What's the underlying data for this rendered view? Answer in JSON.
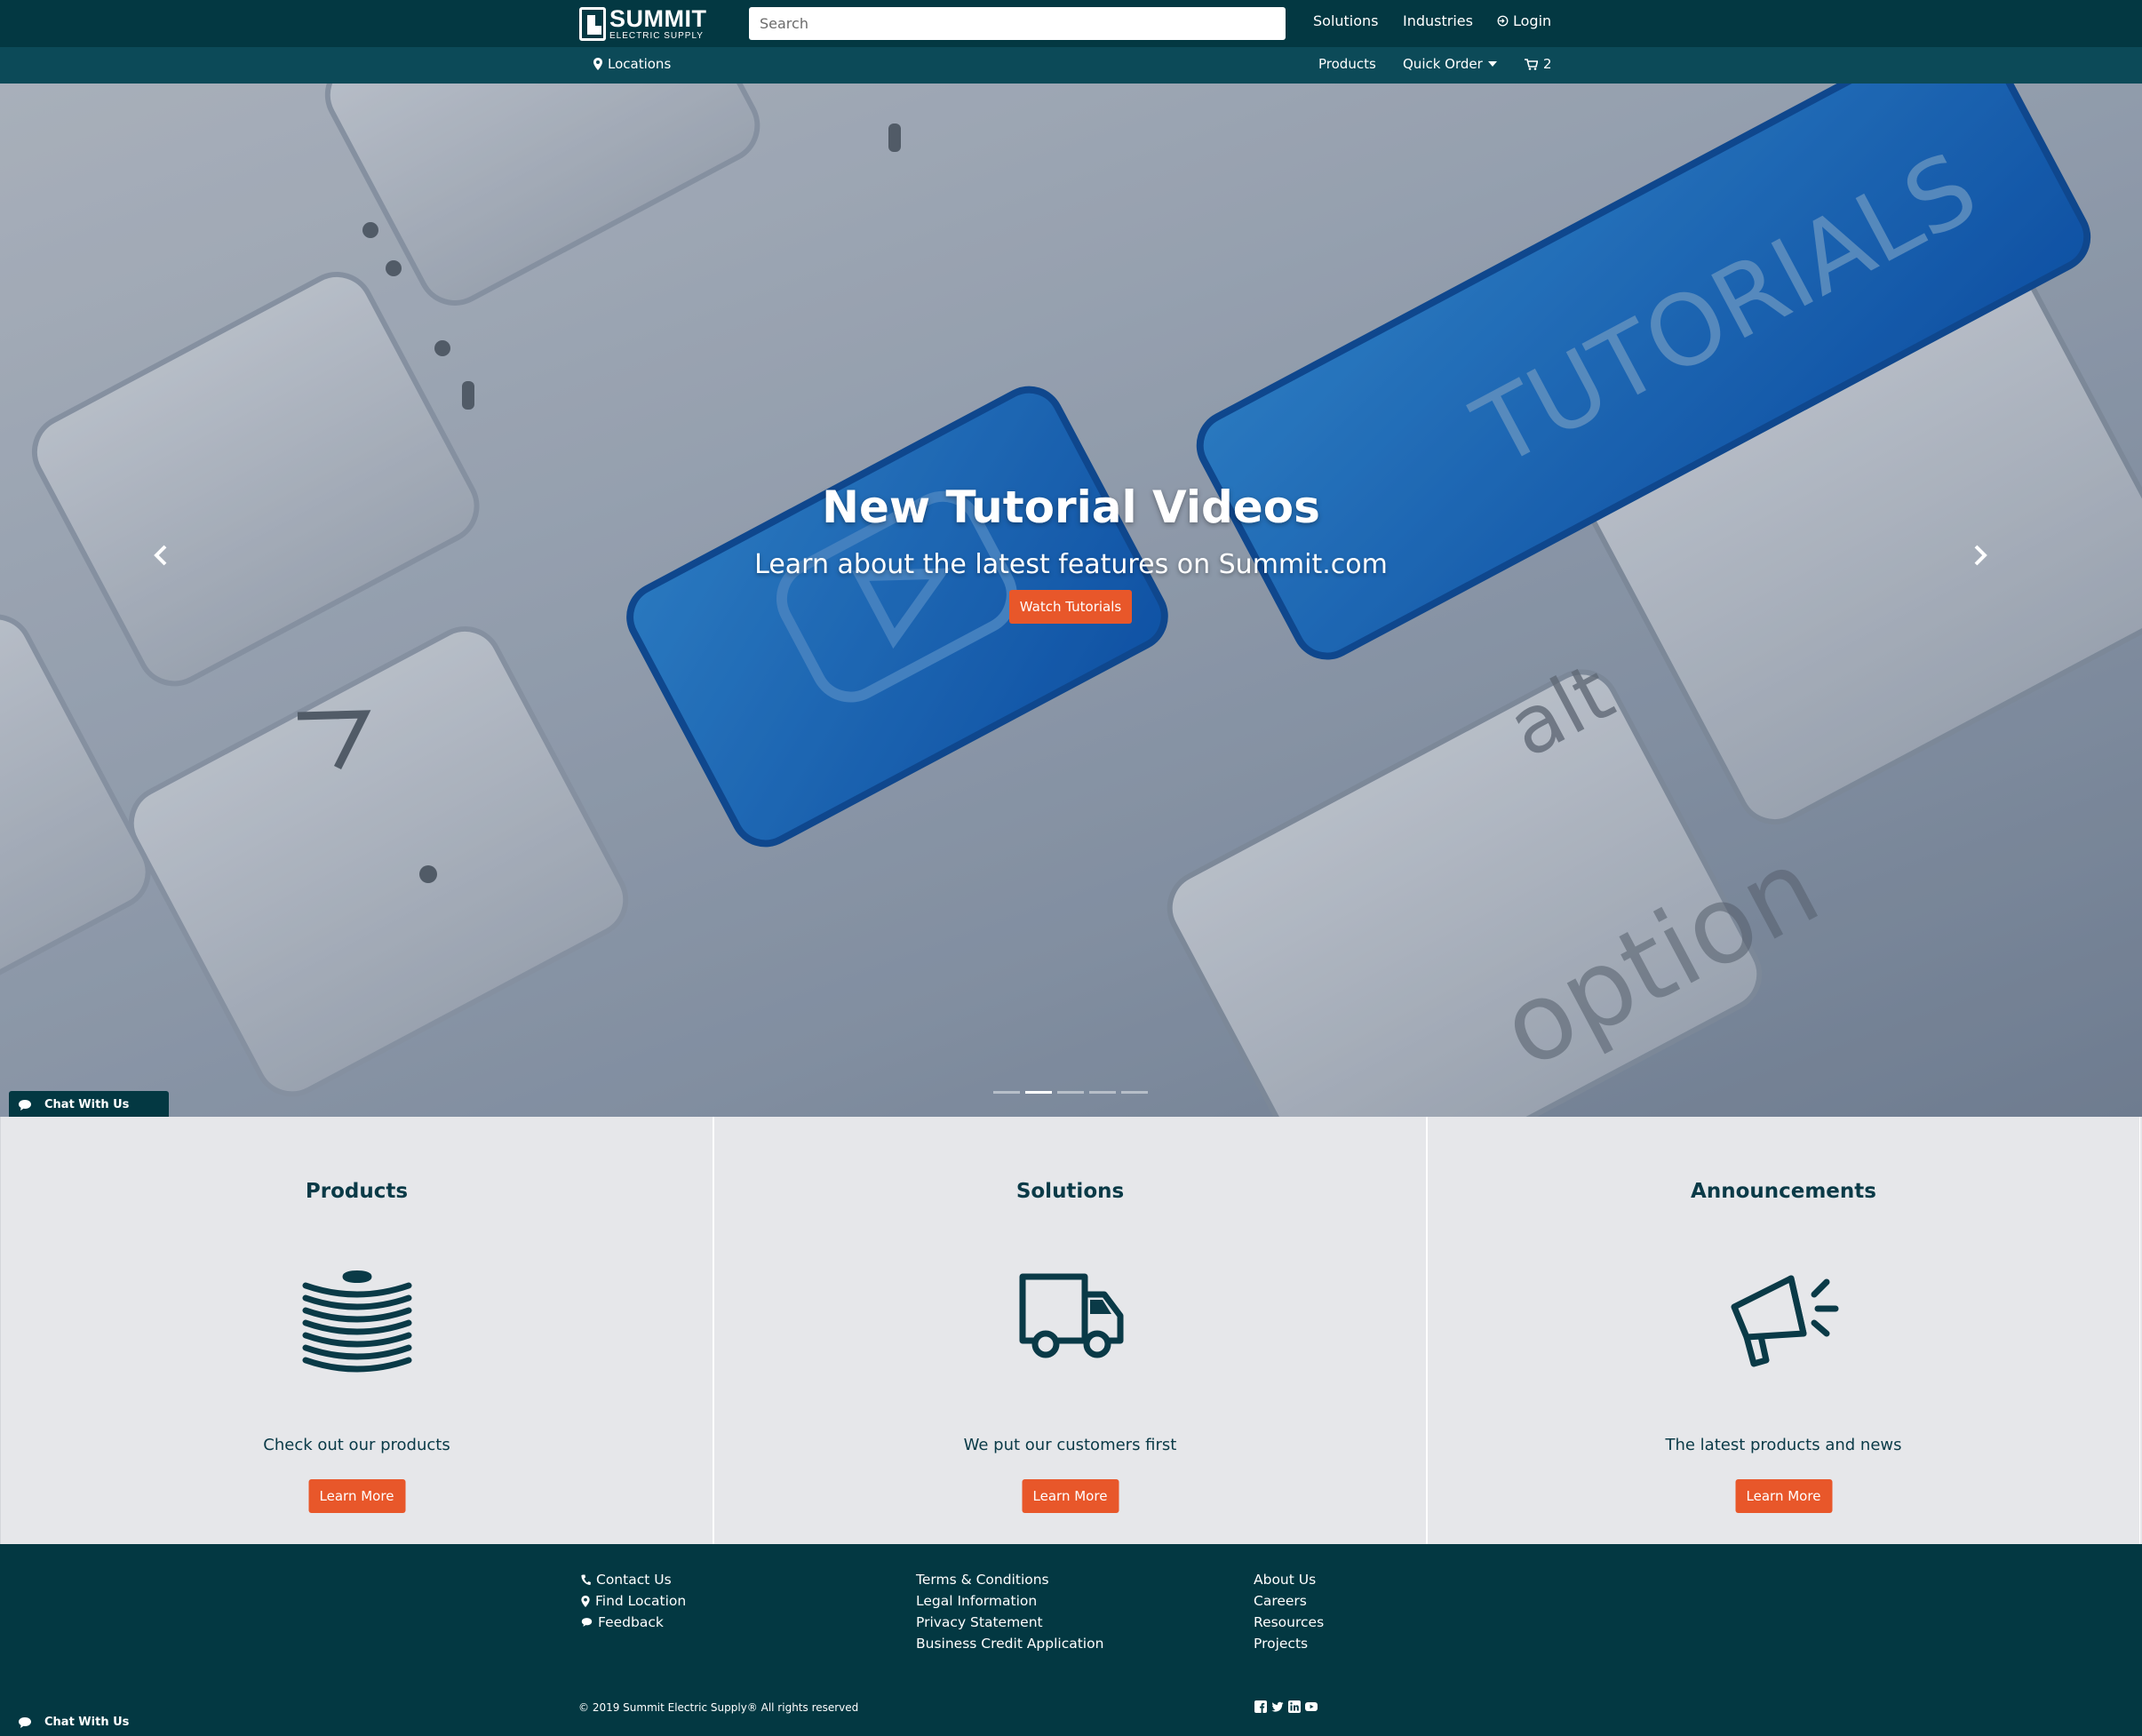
{
  "header": {
    "logo_main": "SUMMIT",
    "logo_sub": "ELECTRIC SUPPLY",
    "search_placeholder": "Search",
    "nav": {
      "solutions": "Solutions",
      "industries": "Industries",
      "login": "Login"
    }
  },
  "subnav": {
    "locations": "Locations",
    "products": "Products",
    "quick_order": "Quick Order",
    "cart_count": "2"
  },
  "hero": {
    "title": "New Tutorial Videos",
    "subtitle": "Learn about the latest features on Summit.com",
    "button": "Watch Tutorials",
    "slide_count": 5,
    "active_slide": 2
  },
  "chat": {
    "label": "Chat With Us"
  },
  "cards": [
    {
      "title": "Products",
      "icon": "wire-spool-icon",
      "text": "Check out our products",
      "button": "Learn More"
    },
    {
      "title": "Solutions",
      "icon": "delivery-truck-icon",
      "text": "We put our customers first",
      "button": "Learn More"
    },
    {
      "title": "Announcements",
      "icon": "megaphone-icon",
      "text": "The latest products and news",
      "button": "Learn More"
    }
  ],
  "footer": {
    "contact": [
      {
        "label": "Contact Us",
        "icon": "phone-icon"
      },
      {
        "label": "Find Location",
        "icon": "map-marker-icon"
      },
      {
        "label": "Feedback",
        "icon": "speech-bubble-icon"
      }
    ],
    "legal": [
      "Terms & Conditions",
      "Legal Information",
      "Privacy Statement",
      "Business Credit Application"
    ],
    "about": [
      "About Us",
      "Careers",
      "Resources",
      "Projects"
    ],
    "copyright": "© 2019 Summit Electric Supply® All rights reserved",
    "social": [
      "facebook-icon",
      "twitter-icon",
      "linkedin-icon",
      "youtube-icon"
    ]
  },
  "colors": {
    "navy": "#033842",
    "subnav": "#0c4a58",
    "accent": "#e8572a",
    "card_bg": "#e6e7ea"
  }
}
